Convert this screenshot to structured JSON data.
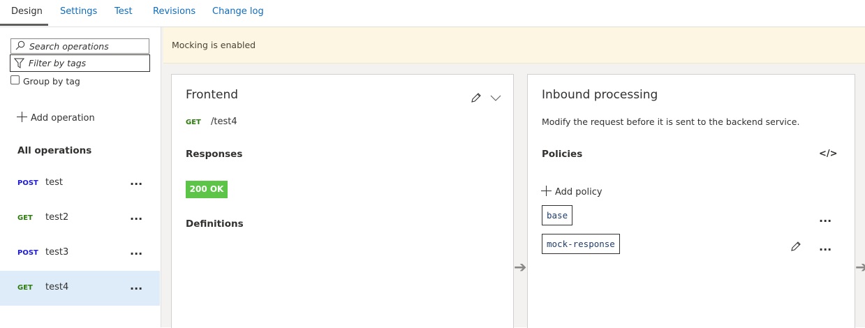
{
  "tabs": [
    {
      "label": "Design"
    },
    {
      "label": "Settings"
    },
    {
      "label": "Test"
    },
    {
      "label": "Revisions"
    },
    {
      "label": "Change log"
    }
  ],
  "left_panel": {
    "search_placeholder": "Search operations",
    "filter_placeholder": "Filter by tags",
    "group_by_tag_label": "Group by tag",
    "add_operation_label": "Add operation",
    "all_operations_label": "All operations",
    "operations": [
      {
        "method": "POST",
        "name": "test"
      },
      {
        "method": "GET",
        "name": "test2"
      },
      {
        "method": "POST",
        "name": "test3"
      },
      {
        "method": "GET",
        "name": "test4",
        "selected": true
      }
    ],
    "more_label": "..."
  },
  "banner": {
    "text": "Mocking is enabled"
  },
  "frontend": {
    "title": "Frontend",
    "method": "GET",
    "path": "/test4",
    "responses_label": "Responses",
    "response_badge": "200 OK",
    "definitions_label": "Definitions"
  },
  "inbound": {
    "title": "Inbound processing",
    "description": "Modify the request before it is sent to the backend service.",
    "policies_label": "Policies",
    "code_icon_text": "</>",
    "add_policy_label": "Add policy",
    "policies": [
      {
        "name": "base"
      },
      {
        "name": "mock-response"
      }
    ]
  },
  "colors": {
    "accent": "#0f6cbd",
    "post": "#1a1ad6",
    "get": "#2b7a0b",
    "ok": "#5cc548",
    "banner": "#fdf6e3",
    "selected": "#deecf9"
  }
}
